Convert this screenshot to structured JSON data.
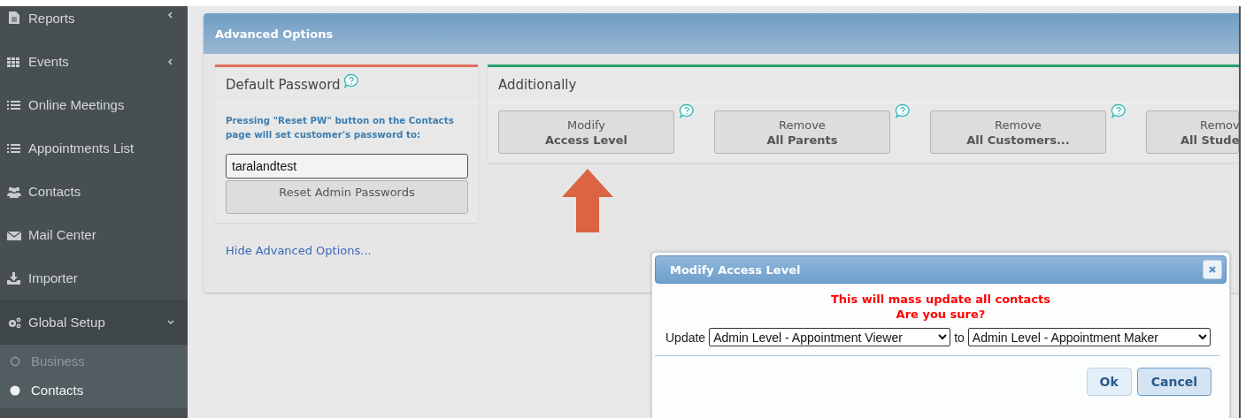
{
  "sidebar": {
    "items": [
      {
        "label": "Reports",
        "expanded": false
      },
      {
        "label": "Events",
        "expanded": false
      },
      {
        "label": "Online Meetings"
      },
      {
        "label": "Appointments List"
      },
      {
        "label": "Contacts"
      },
      {
        "label": "Mail Center"
      },
      {
        "label": "Importer"
      },
      {
        "label": "Global Setup",
        "expanded": true,
        "children": [
          {
            "label": "Business",
            "selected": false
          },
          {
            "label": "Contacts",
            "selected": true
          }
        ]
      }
    ]
  },
  "panel": {
    "title": "Advanced Options",
    "default_password": {
      "title": "Default Password",
      "note": "Pressing \"Reset PW\" button on the Contacts page will set customer's password to:",
      "value": "taralandtest",
      "button": "Reset Admin Passwords"
    },
    "additionally": {
      "title": "Additionally",
      "buttons": [
        {
          "line1": "Modify",
          "line2": "Access Level",
          "help": true
        },
        {
          "line1": "Remove",
          "line2": "All Parents",
          "help": true
        },
        {
          "line1": "Remove",
          "line2": "All Customers...",
          "help": true
        },
        {
          "line1": "Remov",
          "line2": "All Stude",
          "help": false
        }
      ]
    },
    "hide_link": "Hide Advanced Options..."
  },
  "dialog": {
    "title": "Modify Access Level",
    "message": [
      "This will mass update all contacts",
      "Are you sure?"
    ],
    "update_label": "Update",
    "from": "Admin Level - Appointment Viewer",
    "to_label": "to",
    "to": "Admin Level - Appointment Maker",
    "buttons": [
      "Ok",
      "Cancel"
    ]
  }
}
